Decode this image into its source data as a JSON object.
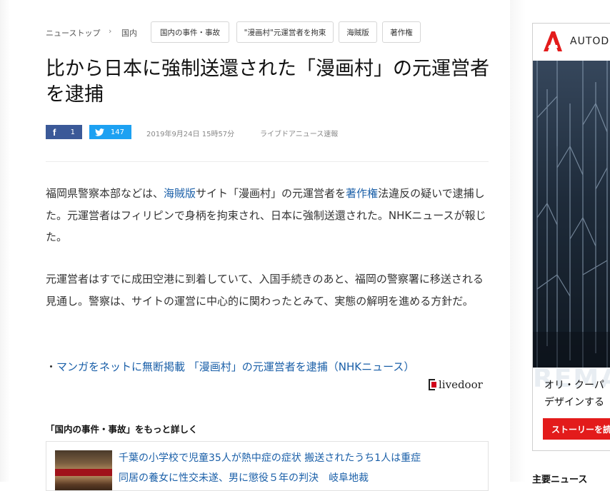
{
  "breadcrumb": {
    "home": "ニューストップ",
    "category": "国内"
  },
  "tags": [
    "国内の事件・事故",
    "\"漫画村\"元運営者を拘束",
    "海賊版",
    "著作権"
  ],
  "article": {
    "title": "比から日本に強制送還された「漫画村」の元運営者を逮捕",
    "share": {
      "facebook_count": "1",
      "twitter_count": "147"
    },
    "date": "2019年9月24日 15時57分",
    "source": "ライブドアニュース速報",
    "para1": {
      "t1": "福岡県警察本部などは、",
      "link1": "海賊版",
      "t2": "サイト「漫画村」の元運営者を",
      "link2": "著作権",
      "t3": "法違反の疑いで逮捕した。元運営者はフィリピンで身柄を拘束され、日本に強制送還された。NHKニュースが報じた。"
    },
    "para2": "元運営者はすでに成田空港に到着していて、入国手続きのあと、福岡の警察署に移送される見通し。警察は、サイトの運営に中心的に関わったとみて、実態の解明を進める方針だ。",
    "source_link_prefix": "・",
    "source_link": "マンガをネットに無断掲載 「漫画村」の元運営者を逮捕（NHKニュース）",
    "logo_text": "livedoor"
  },
  "related": {
    "heading": "「国内の事件・事故」をもっと詳しく",
    "items": [
      "千葉の小学校で児童35人が熱中症の症状 搬送されたうち1人は重症",
      "同居の養女に性交未遂、男に懲役５年の判決　岐阜地裁"
    ]
  },
  "ad": {
    "brand": "AUTODESK",
    "overlay": "REMA",
    "line1": "オリ・クーパ",
    "line2": "デザインする",
    "button": "ストーリーを読",
    "accent": "#e31b1b"
  },
  "sidebar": {
    "heading": "主要ニュース"
  },
  "colors": {
    "link": "#1a5fa8",
    "facebook": "#3b5998",
    "twitter": "#1da1f2"
  }
}
